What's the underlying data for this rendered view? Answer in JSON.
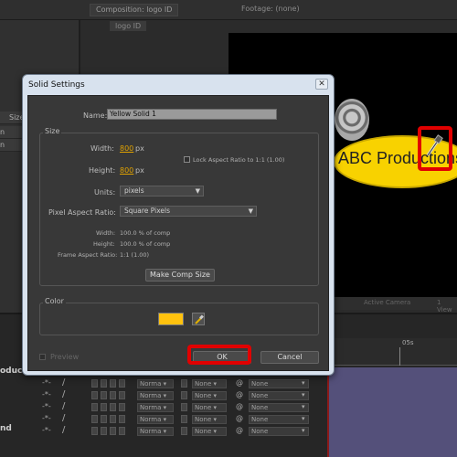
{
  "top_tabs": [
    "Composition: logo ID",
    "Footage: (none)"
  ],
  "sub_tab": "logo ID",
  "project_panel": {
    "column_header": "Size",
    "row_stub": "n"
  },
  "viewer": {
    "logo_text": "ABC Productions"
  },
  "viewer_toolbar": {
    "camera": "Active Camera",
    "views": "1 View"
  },
  "dialog": {
    "title": "Solid Settings",
    "close": "✕",
    "name_label": "Name:",
    "name_value": "Yellow Solid 1",
    "size_group": "Size",
    "width_label": "Width:",
    "width_value": "800",
    "height_label": "Height:",
    "height_value": "800",
    "unit_px": "px",
    "lock_label": "Lock Aspect Ratio to 1:1 (1.00)",
    "units_label": "Units:",
    "units_value": "pixels",
    "par_label": "Pixel Aspect Ratio:",
    "par_value": "Square Pixels",
    "info_width_label": "Width:",
    "info_width_value": "100.0 % of comp",
    "info_height_label": "Height:",
    "info_height_value": "100.0 % of comp",
    "info_far_label": "Frame Aspect Ratio:",
    "info_far_value": "1:1 (1.00)",
    "make_comp_size": "Make Comp Size",
    "color_group": "Color",
    "color_hex": "#ffc20e",
    "preview_label": "Preview",
    "ok": "OK",
    "cancel": "Cancel"
  },
  "timeline": {
    "ruler_time": "05s",
    "left_labels": [
      "oduction",
      "nd"
    ],
    "mode_value": "Norma",
    "trkmat_value": "None",
    "parent_value": "None"
  },
  "colors": {
    "highlight": "#e10000",
    "logo_yellow": "#f8d200"
  }
}
